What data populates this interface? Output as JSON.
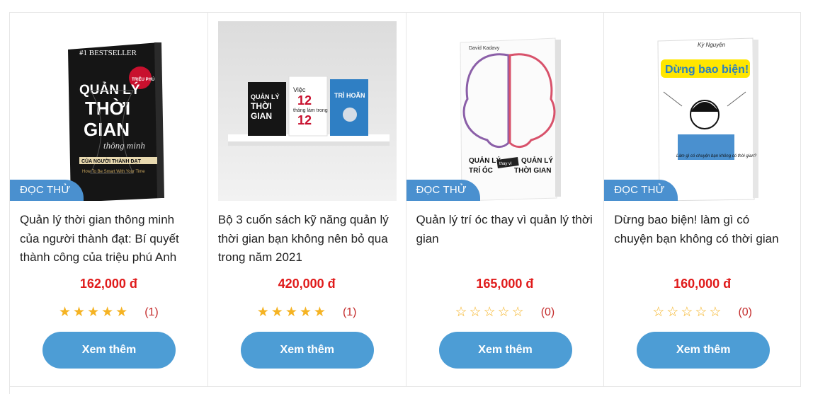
{
  "products": [
    {
      "badge": "ĐỌC THỬ",
      "title": "Quản lý thời gian thông minh của người thành đạt: Bí quyết thành công của triệu phú Anh",
      "price": "162,000 đ",
      "rating": 5,
      "rating_count": "(1)",
      "button": "Xem thêm",
      "cover": {
        "top_text": "#1 BESTSELLER",
        "title_lines": [
          "QUẢN LÝ",
          "THỜI",
          "GIAN"
        ],
        "subtitle": "thông minh",
        "tagline": "CỦA NGƯỜI THÀNH ĐẠT",
        "sticker": "TRIỆU PHÚ ANH"
      }
    },
    {
      "badge": "",
      "title": "Bộ 3 cuốn sách kỹ năng quản lý thời gian bạn không nên bỏ qua trong năm 2021",
      "price": "420,000 đ",
      "rating": 5,
      "rating_count": "(1)",
      "button": "Xem thêm",
      "cover": {
        "book1": [
          "QUẢN LÝ",
          "THỜI",
          "GIAN"
        ],
        "book2": [
          "Việc",
          "12",
          "tháng",
          "làm trong",
          "12",
          "tuần"
        ],
        "book3": "TRÌ HOÃN"
      }
    },
    {
      "badge": "ĐỌC THỬ",
      "title": "Quản lý trí óc thay vì quản lý thời gian",
      "price": "165,000 đ",
      "rating": 0,
      "rating_count": "(0)",
      "button": "Xem thêm",
      "cover": {
        "author": "David Kadavy",
        "left_title": [
          "QUẢN LÝ",
          "TRÍ ÓC"
        ],
        "middle": "thay vì",
        "right_title": [
          "QUẢN LÝ",
          "THỜI GIAN"
        ]
      }
    },
    {
      "badge": "ĐỌC THỬ",
      "title": "Dừng bao biện! làm gì có chuyện bạn không có thời gian",
      "price": "160,000 đ",
      "rating": 0,
      "rating_count": "(0)",
      "button": "Xem thêm",
      "cover": {
        "author": "Kỳ Nguyện",
        "title": "Dừng bao biện!",
        "subtitle": "Làm gì có chuyện bạn không có thời gian?"
      }
    }
  ],
  "colors": {
    "badge": "#4a90cf",
    "price": "#e01b1b",
    "star": "#f5b323",
    "button": "#4d9dd5"
  }
}
